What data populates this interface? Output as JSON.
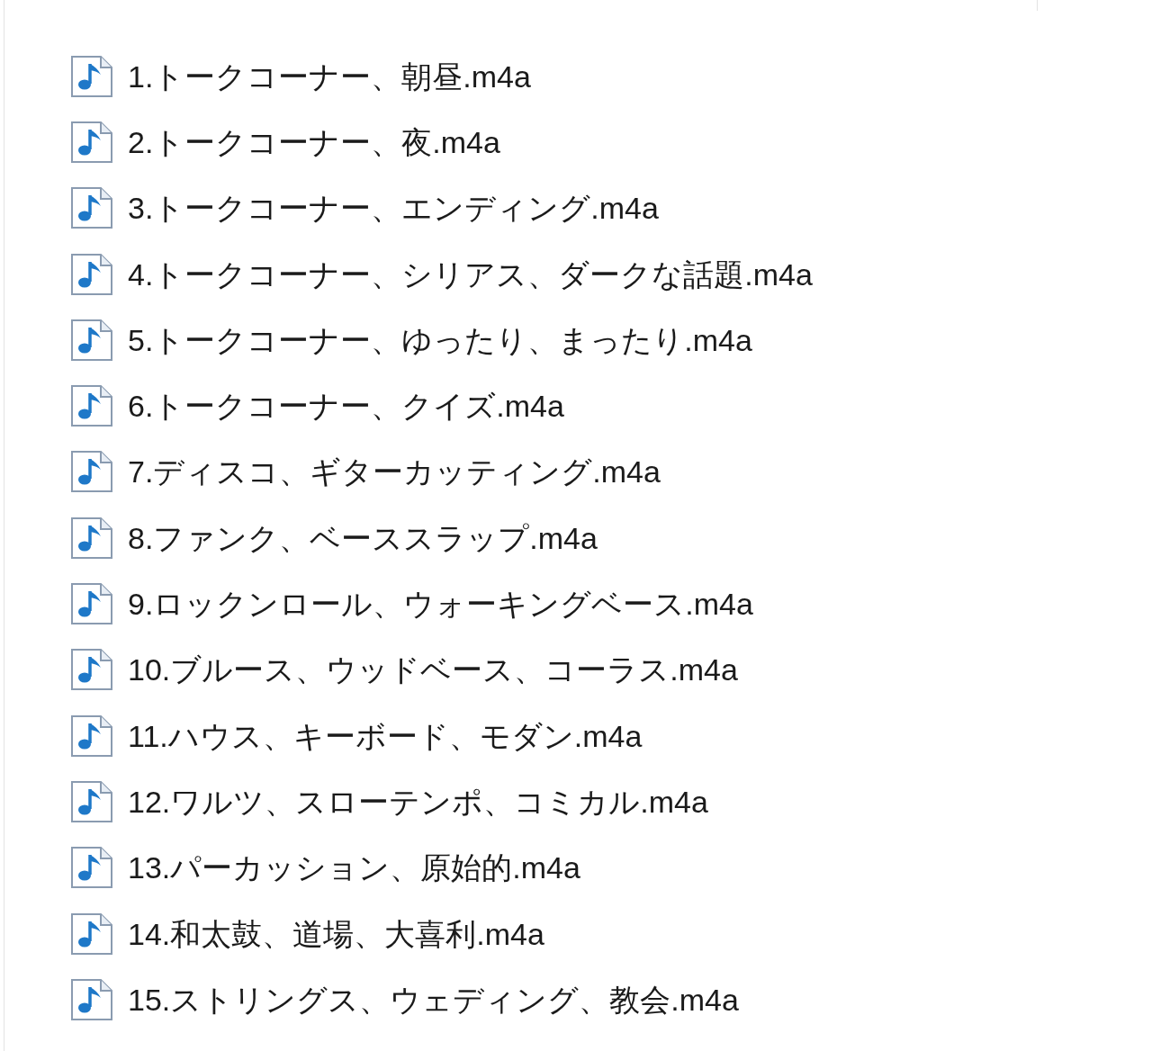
{
  "files": [
    {
      "name": "1.トークコーナー、朝昼.m4a"
    },
    {
      "name": "2.トークコーナー、夜.m4a"
    },
    {
      "name": "3.トークコーナー、エンディング.m4a"
    },
    {
      "name": "4.トークコーナー、シリアス、ダークな話題.m4a"
    },
    {
      "name": "5.トークコーナー、ゆったり、まったり.m4a"
    },
    {
      "name": "6.トークコーナー、クイズ.m4a"
    },
    {
      "name": "7.ディスコ、ギターカッティング.m4a"
    },
    {
      "name": "8.ファンク、ベーススラップ.m4a"
    },
    {
      "name": "9.ロックンロール、ウォーキングベース.m4a"
    },
    {
      "name": "10.ブルース、ウッドベース、コーラス.m4a"
    },
    {
      "name": "11.ハウス、キーボード、モダン.m4a"
    },
    {
      "name": "12.ワルツ、スローテンポ、コミカル.m4a"
    },
    {
      "name": "13.パーカッション、原始的.m4a"
    },
    {
      "name": "14.和太鼓、道場、大喜利.m4a"
    },
    {
      "name": "15.ストリングス、ウェディング、教会.m4a"
    }
  ]
}
